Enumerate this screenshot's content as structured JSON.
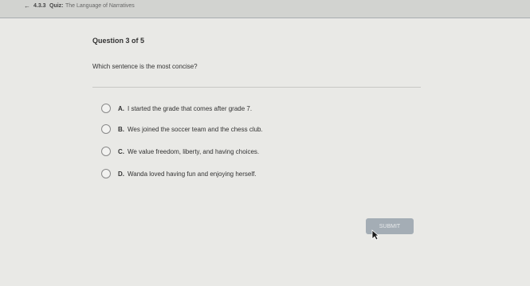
{
  "header": {
    "section_number": "4.3.3",
    "quiz_label": "Quiz:",
    "title": "The Language of Narratives"
  },
  "question": {
    "counter": "Question 3 of 5",
    "prompt": "Which sentence is the most concise?"
  },
  "options": [
    {
      "letter": "A.",
      "text": "I started the grade that comes after grade 7."
    },
    {
      "letter": "B.",
      "text": "Wes joined the soccer team and the chess club."
    },
    {
      "letter": "C.",
      "text": "We value freedom, liberty, and having choices."
    },
    {
      "letter": "D.",
      "text": "Wanda loved having fun and enjoying herself."
    }
  ],
  "submit": {
    "label": "SUBMIT"
  },
  "icons": {
    "back": "back-arrow-icon",
    "cursor": "cursor-icon",
    "radio": "radio-button-icon"
  },
  "colors": {
    "background": "#e9e9e6",
    "header": "#d2d3d0",
    "submit_button": "#a4adb5"
  }
}
